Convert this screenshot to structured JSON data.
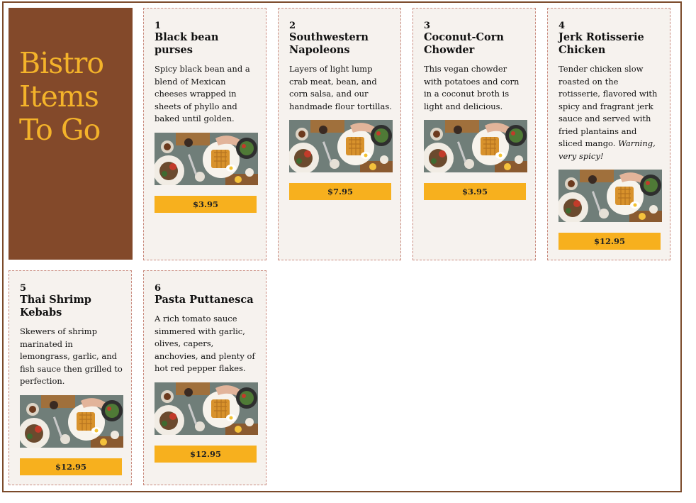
{
  "hero": {
    "title_lines": [
      "Bistro",
      "Items",
      "To Go"
    ]
  },
  "colors": {
    "accent": "#f7b01e",
    "hero_bg": "#83492a",
    "card_bg": "#f6f2ee",
    "border": "#7b4a2a"
  },
  "items": [
    {
      "number": "1",
      "name": "Black bean purses",
      "description": "Spicy black bean and a blend of Mexican cheeses wrapped in sheets of phyllo and baked until golden.",
      "warning": "",
      "price": "$3.95",
      "image_icon": "food-photo-icon"
    },
    {
      "number": "2",
      "name": "Southwestern Napoleons",
      "description": "Layers of light lump crab meat, bean, and corn salsa, and our handmade flour tortillas.",
      "warning": "",
      "price": "$7.95",
      "image_icon": "food-photo-icon"
    },
    {
      "number": "3",
      "name": "Coconut-Corn Chowder",
      "description": "This vegan chowder with potatoes and corn in a coconut broth is light and delicious.",
      "warning": "",
      "price": "$3.95",
      "image_icon": "food-photo-icon"
    },
    {
      "number": "4",
      "name": "Jerk Rotisserie Chicken",
      "description": "Tender chicken slow roasted on the rotisserie, flavored with spicy and fragrant jerk sauce and served with fried plantains and sliced mango.",
      "warning": "Warning, very spicy!",
      "price": "$12.95",
      "image_icon": "food-photo-icon"
    },
    {
      "number": "5",
      "name": "Thai Shrimp Kebabs",
      "description": "Skewers of shrimp marinated in lemongrass, garlic, and fish sauce then grilled to perfection.",
      "warning": "",
      "price": "$12.95",
      "image_icon": "food-photo-icon"
    },
    {
      "number": "6",
      "name": "Pasta Puttanesca",
      "description": "A rich tomato sauce simmered with garlic, olives, capers, anchovies, and plenty of hot red pepper flakes.",
      "warning": "",
      "price": "$12.95",
      "image_icon": "food-photo-icon"
    }
  ]
}
